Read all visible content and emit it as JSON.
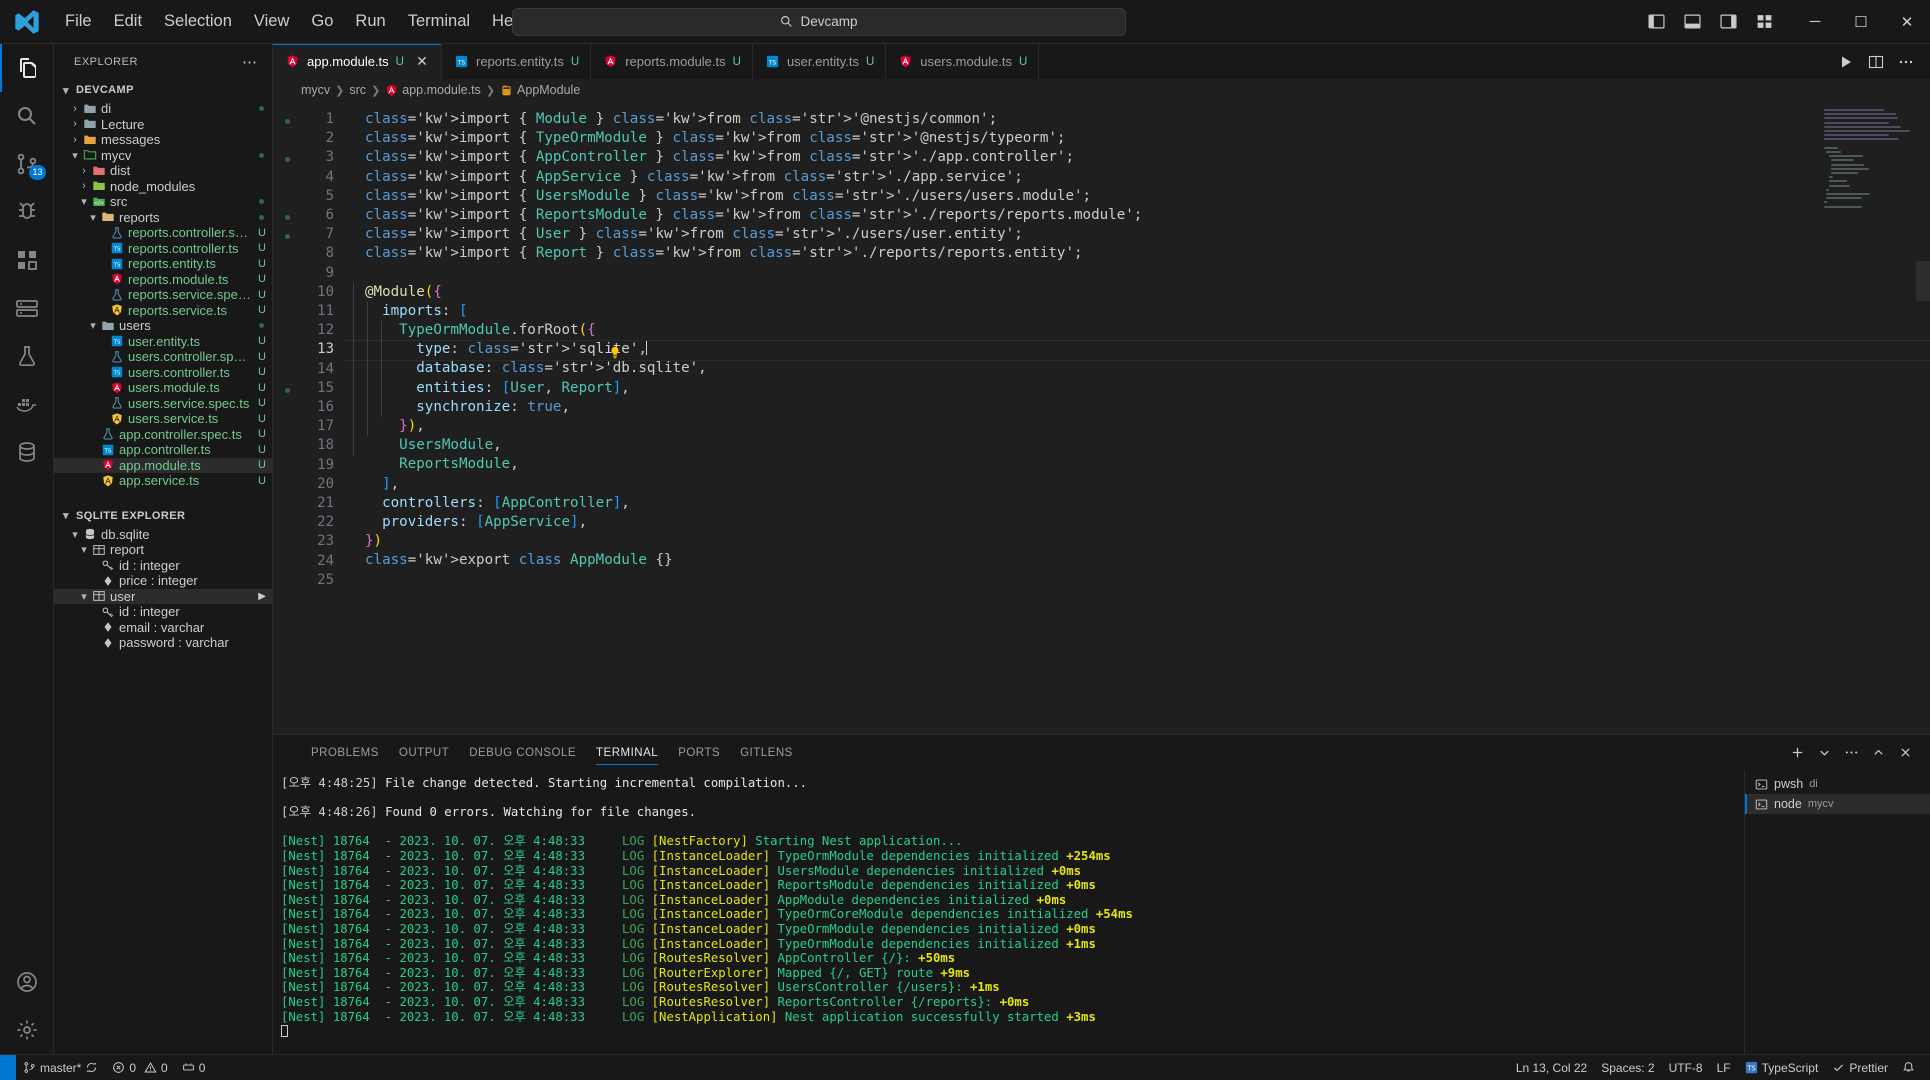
{
  "titlebar": {
    "menus": [
      "File",
      "Edit",
      "Selection",
      "View",
      "Go",
      "Run",
      "Terminal",
      "Help"
    ],
    "back_icon": "arrow-left-icon",
    "forward_icon": "arrow-right-icon",
    "command_center_text": "Devcamp",
    "search_icon": "search-icon",
    "layout_icons": [
      "toggle-primary-sidebar-icon",
      "toggle-panel-icon",
      "toggle-secondary-sidebar-icon",
      "customize-layout-icon"
    ],
    "window_minimize": "─",
    "window_maximize": "☐",
    "window_close": "✕"
  },
  "activitybar": {
    "items": [
      {
        "name": "explorer",
        "icon": "files-icon",
        "active": true,
        "badge": ""
      },
      {
        "name": "search",
        "icon": "search-icon",
        "active": false,
        "badge": ""
      },
      {
        "name": "source-control",
        "icon": "source-control-icon",
        "active": false,
        "badge": "13"
      },
      {
        "name": "run-and-debug",
        "icon": "debug-icon",
        "active": false,
        "badge": ""
      },
      {
        "name": "extensions",
        "icon": "extensions-icon",
        "active": false,
        "badge": ""
      },
      {
        "name": "remote-explorer",
        "icon": "remote-explorer-icon",
        "active": false,
        "badge": ""
      },
      {
        "name": "test-explorer",
        "icon": "beaker-icon",
        "active": false,
        "badge": ""
      },
      {
        "name": "docker",
        "icon": "docker-icon",
        "active": false,
        "badge": ""
      },
      {
        "name": "database",
        "icon": "database-icon",
        "active": false,
        "badge": ""
      }
    ],
    "bottom": [
      {
        "name": "accounts",
        "icon": "account-icon"
      },
      {
        "name": "manage",
        "icon": "gear-icon"
      }
    ]
  },
  "sidebar": {
    "title": "EXPLORER",
    "more_actions": "⋯",
    "root": "DEVCAMP",
    "tree": [
      {
        "label": "di",
        "type": "folder",
        "icon": "folder-gray",
        "depth": 1,
        "expanded": false,
        "badge": "",
        "dot": true
      },
      {
        "label": "Lecture",
        "type": "folder",
        "icon": "folder-gray",
        "depth": 1,
        "expanded": false,
        "badge": "",
        "dot": false
      },
      {
        "label": "messages",
        "type": "folder",
        "icon": "folder-orange",
        "depth": 1,
        "expanded": false,
        "badge": "",
        "dot": false
      },
      {
        "label": "mycv",
        "type": "folder",
        "icon": "folder-green",
        "depth": 1,
        "expanded": true,
        "badge": "",
        "dot": true
      },
      {
        "label": "dist",
        "type": "folder",
        "icon": "folder-red",
        "depth": 2,
        "expanded": false,
        "badge": "",
        "dot": false
      },
      {
        "label": "node_modules",
        "type": "folder",
        "icon": "folder-lime",
        "depth": 2,
        "expanded": false,
        "badge": "",
        "dot": false
      },
      {
        "label": "src",
        "type": "folder",
        "icon": "folder-src",
        "depth": 2,
        "expanded": true,
        "badge": "",
        "dot": true
      },
      {
        "label": "reports",
        "type": "folder",
        "icon": "folder-yellow",
        "depth": 3,
        "expanded": true,
        "badge": "",
        "dot": true
      },
      {
        "label": "reports.controller.spec.ts",
        "type": "file",
        "icon": "flask-icon",
        "depth": 4,
        "badge": "U",
        "dot": false
      },
      {
        "label": "reports.controller.ts",
        "type": "file",
        "icon": "ts-icon",
        "depth": 4,
        "badge": "U",
        "dot": false
      },
      {
        "label": "reports.entity.ts",
        "type": "file",
        "icon": "ts-icon",
        "depth": 4,
        "badge": "U",
        "dot": false
      },
      {
        "label": "reports.module.ts",
        "type": "file",
        "icon": "nest-red-icon",
        "depth": 4,
        "badge": "U",
        "dot": false
      },
      {
        "label": "reports.service.spec.ts",
        "type": "file",
        "icon": "flask-icon",
        "depth": 4,
        "badge": "U",
        "dot": false
      },
      {
        "label": "reports.service.ts",
        "type": "file",
        "icon": "nest-yellow-icon",
        "depth": 4,
        "badge": "U",
        "dot": false
      },
      {
        "label": "users",
        "type": "folder",
        "icon": "folder-gray",
        "depth": 3,
        "expanded": true,
        "badge": "",
        "dot": true
      },
      {
        "label": "user.entity.ts",
        "type": "file",
        "icon": "ts-icon",
        "depth": 4,
        "badge": "U",
        "dot": false
      },
      {
        "label": "users.controller.spec.ts",
        "type": "file",
        "icon": "flask-icon",
        "depth": 4,
        "badge": "U",
        "dot": false
      },
      {
        "label": "users.controller.ts",
        "type": "file",
        "icon": "ts-icon",
        "depth": 4,
        "badge": "U",
        "dot": false
      },
      {
        "label": "users.module.ts",
        "type": "file",
        "icon": "nest-red-icon",
        "depth": 4,
        "badge": "U",
        "dot": false
      },
      {
        "label": "users.service.spec.ts",
        "type": "file",
        "icon": "flask-icon",
        "depth": 4,
        "badge": "U",
        "dot": false
      },
      {
        "label": "users.service.ts",
        "type": "file",
        "icon": "nest-yellow-icon",
        "depth": 4,
        "badge": "U",
        "dot": false
      },
      {
        "label": "app.controller.spec.ts",
        "type": "file",
        "icon": "flask-icon",
        "depth": 3,
        "badge": "U",
        "dot": false
      },
      {
        "label": "app.controller.ts",
        "type": "file",
        "icon": "ts-icon",
        "depth": 3,
        "badge": "U",
        "dot": false
      },
      {
        "label": "app.module.ts",
        "type": "file",
        "icon": "nest-red-icon",
        "depth": 3,
        "badge": "U",
        "dot": false,
        "selected": true
      },
      {
        "label": "app.service.ts",
        "type": "file",
        "icon": "nest-yellow-icon",
        "depth": 3,
        "badge": "U",
        "dot": false
      }
    ],
    "sqlite": {
      "title": "SQLITE EXPLORER",
      "items": [
        {
          "label": "db.sqlite",
          "icon": "database-icon",
          "depth": 1,
          "expanded": true,
          "selected": false
        },
        {
          "label": "report",
          "icon": "table-icon",
          "depth": 2,
          "expanded": true,
          "selected": false
        },
        {
          "label": "id : integer",
          "icon": "key-icon",
          "depth": 3,
          "expanded": null,
          "selected": false
        },
        {
          "label": "price : integer",
          "icon": "field-icon",
          "depth": 3,
          "expanded": null,
          "selected": false
        },
        {
          "label": "user",
          "icon": "table-icon",
          "depth": 2,
          "expanded": true,
          "selected": true
        },
        {
          "label": "id : integer",
          "icon": "key-icon",
          "depth": 3,
          "expanded": null,
          "selected": false
        },
        {
          "label": "email : varchar",
          "icon": "field-icon",
          "depth": 3,
          "expanded": null,
          "selected": false
        },
        {
          "label": "password : varchar",
          "icon": "field-icon",
          "depth": 3,
          "expanded": null,
          "selected": false
        }
      ]
    }
  },
  "editor": {
    "tabs": [
      {
        "label": "app.module.ts",
        "icon": "nest-red-icon",
        "badge": "U",
        "active": true,
        "closable": true
      },
      {
        "label": "reports.entity.ts",
        "icon": "ts-icon",
        "badge": "U",
        "active": false,
        "closable": false
      },
      {
        "label": "reports.module.ts",
        "icon": "nest-red-icon",
        "badge": "U",
        "active": false,
        "closable": false
      },
      {
        "label": "user.entity.ts",
        "icon": "ts-icon",
        "badge": "U",
        "active": false,
        "closable": false
      },
      {
        "label": "users.module.ts",
        "icon": "nest-red-icon",
        "badge": "U",
        "active": false,
        "closable": false
      }
    ],
    "tab_actions": [
      "run-icon",
      "split-editor-icon",
      "more-actions-icon"
    ],
    "breadcrumb": [
      {
        "label": "mycv",
        "icon": ""
      },
      {
        "label": "src",
        "icon": ""
      },
      {
        "label": "app.module.ts",
        "icon": "nest-red-icon"
      },
      {
        "label": "AppModule",
        "icon": "symbol-class-icon"
      }
    ],
    "line_count": 25,
    "current_line": 13,
    "lightbulb_line": 13,
    "lines": [
      "import { Module } from '@nestjs/common';",
      "import { TypeOrmModule } from '@nestjs/typeorm';",
      "import { AppController } from './app.controller';",
      "import { AppService } from './app.service';",
      "import { UsersModule } from './users/users.module';",
      "import { ReportsModule } from './reports/reports.module';",
      "import { User } from './users/user.entity';",
      "import { Report } from './reports/reports.entity';",
      "",
      "@Module({",
      "  imports: [",
      "    TypeOrmModule.forRoot({",
      "      type: 'sqlite',",
      "      database: 'db.sqlite',",
      "      entities: [User, Report],",
      "      synchronize: true,",
      "    }),",
      "    UsersModule,",
      "    ReportsModule,",
      "  ],",
      "  controllers: [AppController],",
      "  providers: [AppService],",
      "})",
      "export class AppModule {}",
      ""
    ]
  },
  "panel": {
    "tabs": [
      "PROBLEMS",
      "OUTPUT",
      "DEBUG CONSOLE",
      "TERMINAL",
      "PORTS",
      "GITLENS"
    ],
    "active_tab": "TERMINAL",
    "actions": [
      "new-terminal-icon",
      "terminal-dropdown-icon",
      "more-actions-icon",
      "maximize-panel-icon",
      "close-panel-icon"
    ],
    "terminal_lines": [
      {
        "kind": "compile",
        "ts": "[오후 4:48:25]",
        "text": " File change detected. Starting incremental compilation..."
      },
      {
        "kind": "blank",
        "ts": "",
        "text": ""
      },
      {
        "kind": "compile",
        "ts": "[오후 4:48:26]",
        "text": " Found 0 errors. Watching for file changes."
      },
      {
        "kind": "blank",
        "ts": "",
        "text": ""
      },
      {
        "kind": "nest",
        "prefix": "[Nest] 18764  - ",
        "date": "2023. 10. 07. 오후 4:48:33",
        "level": "LOG",
        "ctx": "[NestFactory]",
        "msg": " Starting Nest application...",
        "ms": ""
      },
      {
        "kind": "nest",
        "prefix": "[Nest] 18764  - ",
        "date": "2023. 10. 07. 오후 4:48:33",
        "level": "LOG",
        "ctx": "[InstanceLoader]",
        "msg": " TypeOrmModule dependencies initialized",
        "ms": " +254ms"
      },
      {
        "kind": "nest",
        "prefix": "[Nest] 18764  - ",
        "date": "2023. 10. 07. 오후 4:48:33",
        "level": "LOG",
        "ctx": "[InstanceLoader]",
        "msg": " UsersModule dependencies initialized",
        "ms": " +0ms"
      },
      {
        "kind": "nest",
        "prefix": "[Nest] 18764  - ",
        "date": "2023. 10. 07. 오후 4:48:33",
        "level": "LOG",
        "ctx": "[InstanceLoader]",
        "msg": " ReportsModule dependencies initialized",
        "ms": " +0ms"
      },
      {
        "kind": "nest",
        "prefix": "[Nest] 18764  - ",
        "date": "2023. 10. 07. 오후 4:48:33",
        "level": "LOG",
        "ctx": "[InstanceLoader]",
        "msg": " AppModule dependencies initialized",
        "ms": " +0ms"
      },
      {
        "kind": "nest",
        "prefix": "[Nest] 18764  - ",
        "date": "2023. 10. 07. 오후 4:48:33",
        "level": "LOG",
        "ctx": "[InstanceLoader]",
        "msg": " TypeOrmCoreModule dependencies initialized",
        "ms": " +54ms"
      },
      {
        "kind": "nest",
        "prefix": "[Nest] 18764  - ",
        "date": "2023. 10. 07. 오후 4:48:33",
        "level": "LOG",
        "ctx": "[InstanceLoader]",
        "msg": " TypeOrmModule dependencies initialized",
        "ms": " +0ms"
      },
      {
        "kind": "nest",
        "prefix": "[Nest] 18764  - ",
        "date": "2023. 10. 07. 오후 4:48:33",
        "level": "LOG",
        "ctx": "[InstanceLoader]",
        "msg": " TypeOrmModule dependencies initialized",
        "ms": " +1ms"
      },
      {
        "kind": "nest",
        "prefix": "[Nest] 18764  - ",
        "date": "2023. 10. 07. 오후 4:48:33",
        "level": "LOG",
        "ctx": "[RoutesResolver]",
        "msg": " AppController {/}:",
        "ms": " +50ms"
      },
      {
        "kind": "nest",
        "prefix": "[Nest] 18764  - ",
        "date": "2023. 10. 07. 오후 4:48:33",
        "level": "LOG",
        "ctx": "[RouterExplorer]",
        "msg": " Mapped {/, GET} route",
        "ms": " +9ms"
      },
      {
        "kind": "nest",
        "prefix": "[Nest] 18764  - ",
        "date": "2023. 10. 07. 오후 4:48:33",
        "level": "LOG",
        "ctx": "[RoutesResolver]",
        "msg": " UsersController {/users}:",
        "ms": " +1ms"
      },
      {
        "kind": "nest",
        "prefix": "[Nest] 18764  - ",
        "date": "2023. 10. 07. 오후 4:48:33",
        "level": "LOG",
        "ctx": "[RoutesResolver]",
        "msg": " ReportsController {/reports}:",
        "ms": " +0ms"
      },
      {
        "kind": "nest",
        "prefix": "[Nest] 18764  - ",
        "date": "2023. 10. 07. 오후 4:48:33",
        "level": "LOG",
        "ctx": "[NestApplication]",
        "msg": " Nest application successfully started",
        "ms": " +3ms"
      }
    ],
    "terminal_list": [
      {
        "name": "pwsh",
        "cwd": "di",
        "active": false
      },
      {
        "name": "node",
        "cwd": "mycv",
        "active": true
      }
    ]
  },
  "statusbar": {
    "remote_icon": "remote-icon",
    "branch": "master*",
    "sync_icon": "sync-icon",
    "errors": "0",
    "warnings": "0",
    "ports": "0",
    "cursor": "Ln 13, Col 22",
    "spaces": "Spaces: 2",
    "encoding": "UTF-8",
    "eol": "LF",
    "language": "TypeScript",
    "prettier": "Prettier",
    "bell_icon": "bell-icon",
    "error_icon": "error-icon",
    "warning_icon": "warning-icon",
    "ports_icon": "ports-icon",
    "check_icon": "check-icon"
  }
}
